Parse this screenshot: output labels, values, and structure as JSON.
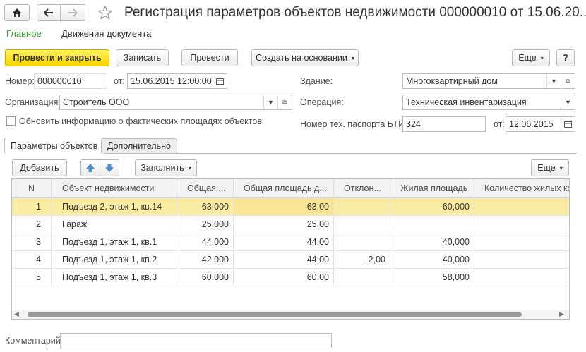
{
  "window": {
    "title": "Регистрация параметров объектов недвижимости 000000010 от 15.06.20...",
    "more_icon": "⋮",
    "expand_icon": "↗",
    "close_icon": "×"
  },
  "nav_tabs": {
    "main": "Главное",
    "movements": "Движения документа"
  },
  "toolbar": {
    "post_close": "Провести и закрыть",
    "write": "Записать",
    "post": "Провести",
    "create_based": "Создать на основании",
    "more": "Еще",
    "help": "?"
  },
  "form": {
    "number_label": "Номер:",
    "number_value": "000000010",
    "date_label": "от:",
    "date_value": "15.06.2015 12:00:00",
    "org_label": "Организация:",
    "org_value": "Строитель ООО",
    "update_checkbox_label": "Обновить информацию о фактических площадях объектов",
    "update_checked": false,
    "building_label": "Здание:",
    "building_value": "Многоквартирный дом",
    "operation_label": "Операция:",
    "operation_value": "Техническая инвентаризация",
    "bti_label": "Номер тех. паспорта БТИ:",
    "bti_value": "324",
    "bti_date_label": "от:",
    "bti_date_value": "12.06.2015",
    "comment_label": "Комментарий:",
    "comment_value": ""
  },
  "tabs": {
    "objects": "Параметры объектов",
    "extra": "Дополнительно"
  },
  "table_toolbar": {
    "add": "Добавить",
    "fill": "Заполнить",
    "more": "Еще"
  },
  "table": {
    "columns": [
      "N",
      "Объект недвижимости",
      "Общая ...",
      "Общая площадь д...",
      "Отклон...",
      "Жилая площадь",
      "Количество жилых ком"
    ],
    "rows": [
      {
        "n": "1",
        "object": "Подъезд 2, этаж 1, кв.14",
        "total": "63,000",
        "total_doc": "63,00",
        "dev": "",
        "living": "60,000",
        "rooms": ""
      },
      {
        "n": "2",
        "object": "Гараж",
        "total": "25,000",
        "total_doc": "25,00",
        "dev": "",
        "living": "",
        "rooms": ""
      },
      {
        "n": "3",
        "object": "Подъезд 1, этаж 1, кв.1",
        "total": "44,000",
        "total_doc": "44,00",
        "dev": "",
        "living": "40,000",
        "rooms": ""
      },
      {
        "n": "4",
        "object": "Подъезд 1, этаж 1, кв.2",
        "total": "42,000",
        "total_doc": "44,00",
        "dev": "-2,00",
        "living": "40,000",
        "rooms": ""
      },
      {
        "n": "5",
        "object": "Подъезд 1, этаж 1, кв.3",
        "total": "60,000",
        "total_doc": "60,00",
        "dev": "",
        "living": "58,000",
        "rooms": ""
      }
    ],
    "selected_row": 0
  },
  "colors": {
    "accent_green": "#3aa035",
    "primary_yellow": "#f8d500",
    "selected_row": "#fbeca3"
  }
}
